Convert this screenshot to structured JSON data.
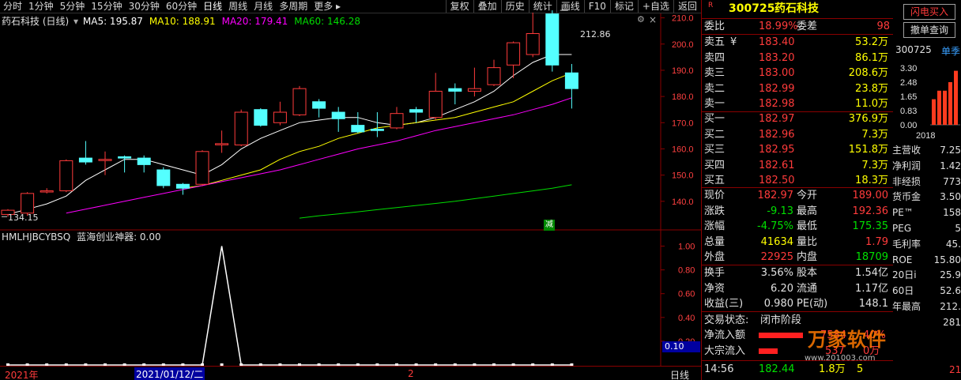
{
  "toolbar": {
    "periods": [
      "分时",
      "1分钟",
      "5分钟",
      "15分钟",
      "30分钟",
      "60分钟",
      "日线",
      "周线",
      "月线",
      "多周期",
      "更多"
    ],
    "active_period": "日线",
    "tools": [
      "复权",
      "叠加",
      "历史",
      "统计",
      "画线",
      "F10",
      "标记",
      "+自选",
      "返回"
    ]
  },
  "chart": {
    "title": "药石科技 (日线)",
    "ma": [
      {
        "label": "MA5: 195.87",
        "color": "#ffffff"
      },
      {
        "label": "MA10: 188.91",
        "color": "#ffff00"
      },
      {
        "label": "MA20: 179.41",
        "color": "#ff00ff"
      },
      {
        "label": "MA60: 146.28",
        "color": "#00dd00"
      }
    ],
    "price_ticks": [
      "210.0",
      "200.0",
      "190.0",
      "180.0",
      "170.0",
      "160.0",
      "150.0",
      "140.0"
    ],
    "high_label": "212.86",
    "low_label": "134.15",
    "reduce_badge": "减",
    "ind_title": "HMLHJBCYBSQ",
    "ind_name": "蓝海创业神器: 0.00",
    "ind_ticks": [
      "1.00",
      "0.80",
      "0.60",
      "0.40",
      "0.20"
    ],
    "ind_value_box": "0.10",
    "date_labels": [
      "2021年",
      "2021/01/12/二",
      "2"
    ],
    "period_label": "日线",
    "chart_data": {
      "type": "candlestick",
      "ylim": [
        130,
        215
      ],
      "candles": [
        {
          "o": 135.0,
          "c": 136.6,
          "h": 137.0,
          "l": 134.15
        },
        {
          "o": 135.5,
          "c": 143.0,
          "h": 143.5,
          "l": 134.5
        },
        {
          "o": 143.8,
          "c": 144.0,
          "h": 145.0,
          "l": 143.0
        },
        {
          "o": 144.0,
          "c": 155.5,
          "h": 156.0,
          "l": 143.5
        },
        {
          "o": 156.5,
          "c": 155.0,
          "h": 163.0,
          "l": 154.0
        },
        {
          "o": 155.8,
          "c": 156.0,
          "h": 159.0,
          "l": 150.0
        },
        {
          "o": 157.0,
          "c": 156.5,
          "h": 157.5,
          "l": 151.0
        },
        {
          "o": 156.5,
          "c": 154.0,
          "h": 157.5,
          "l": 151.0
        },
        {
          "o": 152.0,
          "c": 146.0,
          "h": 153.0,
          "l": 145.0
        },
        {
          "o": 146.5,
          "c": 145.0,
          "h": 147.0,
          "l": 142.5
        },
        {
          "o": 146.5,
          "c": 159.0,
          "h": 159.5,
          "l": 146.0
        },
        {
          "o": 162.0,
          "c": 162.0,
          "h": 167.0,
          "l": 158.5
        },
        {
          "o": 161.5,
          "c": 174.0,
          "h": 175.0,
          "l": 161.0
        },
        {
          "o": 175.0,
          "c": 169.0,
          "h": 175.5,
          "l": 168.5
        },
        {
          "o": 170.0,
          "c": 174.0,
          "h": 178.0,
          "l": 169.0
        },
        {
          "o": 173.0,
          "c": 183.0,
          "h": 184.0,
          "l": 172.5
        },
        {
          "o": 178.0,
          "c": 175.5,
          "h": 179.0,
          "l": 172.0
        },
        {
          "o": 174.0,
          "c": 171.5,
          "h": 176.0,
          "l": 166.5
        },
        {
          "o": 169.0,
          "c": 166.5,
          "h": 174.0,
          "l": 166.0
        },
        {
          "o": 167.5,
          "c": 167.0,
          "h": 174.0,
          "l": 164.5
        },
        {
          "o": 168.0,
          "c": 173.5,
          "h": 176.0,
          "l": 167.5
        },
        {
          "o": 175.0,
          "c": 174.0,
          "h": 176.0,
          "l": 170.0
        },
        {
          "o": 172.0,
          "c": 182.0,
          "h": 189.0,
          "l": 171.0
        },
        {
          "o": 183.0,
          "c": 182.0,
          "h": 185.0,
          "l": 177.0
        },
        {
          "o": 182.0,
          "c": 183.0,
          "h": 191.0,
          "l": 180.0
        },
        {
          "o": 184.5,
          "c": 191.0,
          "h": 194.0,
          "l": 184.0
        },
        {
          "o": 192.0,
          "c": 200.5,
          "h": 201.0,
          "l": 187.0
        },
        {
          "o": 196.0,
          "c": 204.0,
          "h": 212.0,
          "l": 195.0
        },
        {
          "o": 211.5,
          "c": 192.0,
          "h": 212.86,
          "l": 189.5
        },
        {
          "o": 189.0,
          "c": 183.0,
          "h": 192.4,
          "l": 175.4
        }
      ],
      "series": [
        {
          "name": "MA5",
          "color": "#ffffff",
          "values": [
            135,
            137,
            139,
            142,
            148,
            152,
            156,
            156,
            154,
            152,
            150,
            154,
            160,
            164,
            167,
            170,
            171,
            172,
            172,
            170,
            169,
            170,
            172,
            175,
            178,
            182,
            188,
            193,
            196,
            196
          ]
        },
        {
          "name": "MA10",
          "color": "#ffff00",
          "values": [
            null,
            null,
            null,
            null,
            null,
            null,
            null,
            null,
            null,
            145,
            146,
            148,
            150,
            152,
            156,
            159,
            161,
            164,
            166,
            168,
            169,
            170,
            171,
            172,
            174,
            176,
            178,
            182,
            186,
            189
          ]
        },
        {
          "name": "MA20",
          "color": "#ff00ff",
          "values": [
            null,
            null,
            null,
            135.5,
            137,
            138.5,
            140,
            141.5,
            143,
            144.5,
            146,
            147.5,
            149,
            150.5,
            152,
            154,
            156,
            158,
            160,
            161.5,
            163,
            165,
            167,
            168.5,
            170,
            171.5,
            173,
            175,
            177,
            179.5
          ]
        },
        {
          "name": "MA60",
          "color": "#00dd00",
          "values": [
            null,
            null,
            null,
            null,
            null,
            null,
            null,
            null,
            null,
            null,
            null,
            null,
            null,
            null,
            null,
            133.6,
            134.5,
            135.2,
            136,
            136.8,
            137.6,
            138.4,
            139.2,
            140,
            141,
            142,
            143,
            144,
            145,
            146.3
          ]
        }
      ],
      "indicator": {
        "name": "HMLHJBCYBSQ",
        "ylim": [
          0,
          1.05
        ],
        "values": [
          0,
          0,
          0,
          0,
          0,
          0,
          0,
          0,
          0,
          0,
          0,
          1,
          0,
          0,
          0,
          0,
          0,
          0,
          0,
          0,
          0,
          0,
          0,
          0,
          0,
          0,
          0,
          0,
          0,
          0
        ]
      }
    }
  },
  "quote": {
    "code": "300725",
    "name": "药石科技",
    "r_mark": "R",
    "weibi_label": "委比",
    "weibi": "18.99%",
    "weicha_label": "委差",
    "weicha": "98",
    "asks": [
      {
        "label": "卖五",
        "cur": "¥",
        "price": "183.40",
        "vol": "53.2万"
      },
      {
        "label": "卖四",
        "price": "183.20",
        "vol": "86.1万"
      },
      {
        "label": "卖三",
        "price": "183.00",
        "vol": "208.6万"
      },
      {
        "label": "卖二",
        "price": "182.99",
        "vol": "23.8万"
      },
      {
        "label": "卖一",
        "price": "182.98",
        "vol": "11.0万"
      }
    ],
    "bids": [
      {
        "label": "买一",
        "price": "182.97",
        "vol": "376.9万"
      },
      {
        "label": "买二",
        "price": "182.96",
        "vol": "7.3万"
      },
      {
        "label": "买三",
        "price": "182.95",
        "vol": "151.8万"
      },
      {
        "label": "买四",
        "price": "182.61",
        "vol": "7.3万"
      },
      {
        "label": "买五",
        "price": "182.50",
        "vol": "18.3万"
      }
    ],
    "stats": [
      {
        "l1": "现价",
        "v1": "182.97",
        "c1": "#ff3b3b",
        "l2": "今开",
        "v2": "189.00",
        "c2": "#ff3b3b"
      },
      {
        "l1": "涨跌",
        "v1": "-9.13",
        "c1": "#00e000",
        "l2": "最高",
        "v2": "192.36",
        "c2": "#ff3b3b"
      },
      {
        "l1": "涨幅",
        "v1": "-4.75%",
        "c1": "#00e000",
        "l2": "最低",
        "v2": "175.35",
        "c2": "#00e000"
      },
      {
        "l1": "总量",
        "v1": "41634",
        "c1": "#ffff00",
        "l2": "量比",
        "v2": "1.79",
        "c2": "#ff3b3b"
      },
      {
        "l1": "外盘",
        "v1": "22925",
        "c1": "#ff3b3b",
        "l2": "内盘",
        "v2": "18709",
        "c2": "#00e000"
      }
    ],
    "fin": [
      {
        "l1": "换手",
        "v1": "3.56%",
        "l2": "股本",
        "v2": "1.54亿"
      },
      {
        "l1": "净资",
        "v1": "6.20",
        "l2": "流通",
        "v2": "1.17亿"
      },
      {
        "l1": "收益(三)",
        "v1": "0.980",
        "l2": "PE(动)",
        "v2": "148.1"
      }
    ],
    "status_label": "交易状态:",
    "status": "闭市阶段",
    "netflow_label": "净流入额",
    "netflow_val": "7584",
    "netflow_val2": "40%",
    "block_label": "大宗流入",
    "block_val": "537",
    "block_val2": "0万",
    "tick_time": "14:56",
    "tick_price": "182.44",
    "tick_vol": "1.8万",
    "tick_vol2": "5",
    "watermark": "万家软件",
    "watermark_url": "www.201003.com"
  },
  "far": {
    "flash_buy": "闪电买入",
    "cancel_query": "撤单查询",
    "code": "300725",
    "tab": "单季",
    "bar_ticks": [
      "3.30",
      "2.48",
      "1.65",
      "0.83",
      "0.00"
    ],
    "year": "2018",
    "bars": [
      0.45,
      0.6,
      0.6,
      0.75,
      0.95
    ],
    "metrics": [
      {
        "label": "主营收",
        "value": "7.25"
      },
      {
        "label": "净利润",
        "value": "1.42"
      },
      {
        "label": "非经损",
        "value": "773"
      },
      {
        "label": "货币金",
        "value": "3.50"
      },
      {
        "label": "PE™",
        "value": "158"
      },
      {
        "label": "PEG",
        "value": "5"
      },
      {
        "label": "毛利率",
        "value": "45."
      },
      {
        "label": "ROE",
        "value": "15.80"
      },
      {
        "label": "20日i",
        "value": "25.9"
      },
      {
        "label": "60日",
        "value": "52.6"
      },
      {
        "label": "年最高",
        "value": "212."
      },
      {
        "label": "",
        "value": "281"
      }
    ],
    "bottom": "21"
  }
}
